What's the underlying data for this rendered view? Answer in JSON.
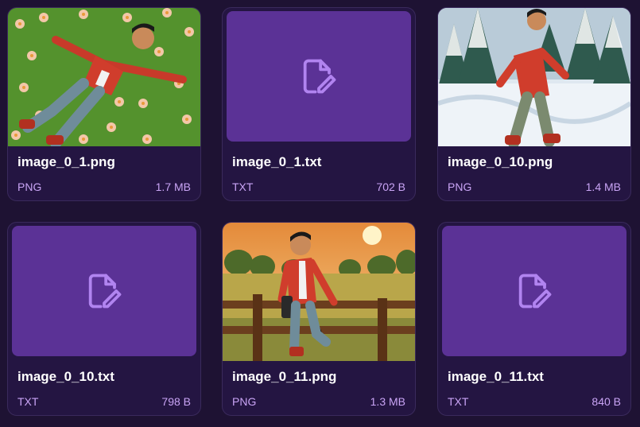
{
  "files": [
    {
      "name": "image_0_1.png",
      "type": "PNG",
      "size": "1.7 MB",
      "thumbnail": "image",
      "scene": "meadow"
    },
    {
      "name": "image_0_1.txt",
      "type": "TXT",
      "size": "702 B",
      "thumbnail": "file-edit-icon"
    },
    {
      "name": "image_0_10.png",
      "type": "PNG",
      "size": "1.4 MB",
      "thumbnail": "image",
      "scene": "snow"
    },
    {
      "name": "image_0_10.txt",
      "type": "TXT",
      "size": "798 B",
      "thumbnail": "file-edit-icon"
    },
    {
      "name": "image_0_11.png",
      "type": "PNG",
      "size": "1.3 MB",
      "thumbnail": "image",
      "scene": "sunset"
    },
    {
      "name": "image_0_11.txt",
      "type": "TXT",
      "size": "840 B",
      "thumbnail": "file-edit-icon"
    }
  ],
  "colors": {
    "background": "#1e1233",
    "card": "#241542",
    "file_thumb": "#5b3296",
    "icon": "#b184f0",
    "meta_text": "#c9a4f5"
  }
}
